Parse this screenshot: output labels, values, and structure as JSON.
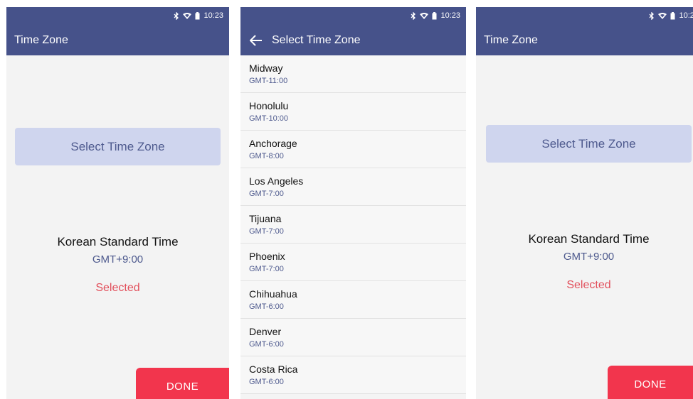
{
  "status_time": "10:23",
  "left_screen": {
    "title": "Time Zone",
    "select_button_label": "Select Time Zone",
    "timezone_name": "Korean Standard Time",
    "timezone_offset": "GMT+9:00",
    "selected_label": "Selected",
    "done_label": "DONE"
  },
  "middle_screen": {
    "title": "Select Time Zone",
    "items": [
      {
        "city": "Midway",
        "offset": "GMT-11:00"
      },
      {
        "city": "Honolulu",
        "offset": "GMT-10:00"
      },
      {
        "city": "Anchorage",
        "offset": "GMT-8:00"
      },
      {
        "city": "Los Angeles",
        "offset": "GMT-7:00"
      },
      {
        "city": "Tijuana",
        "offset": "GMT-7:00"
      },
      {
        "city": "Phoenix",
        "offset": "GMT-7:00"
      },
      {
        "city": "Chihuahua",
        "offset": "GMT-6:00"
      },
      {
        "city": "Denver",
        "offset": "GMT-6:00"
      },
      {
        "city": "Costa Rica",
        "offset": "GMT-6:00"
      }
    ]
  },
  "right_screen": {
    "title": "Time Zone",
    "select_button_label": "Select Time Zone",
    "timezone_name": "Korean Standard Time",
    "timezone_offset": "GMT+9:00",
    "selected_label": "Selected",
    "done_label": "DONE"
  },
  "icons": {
    "status": [
      "bluetooth-icon",
      "wifi-icon",
      "battery-icon"
    ],
    "back": "arrow-left-icon"
  },
  "colors": {
    "app_bar": "#46528a",
    "select_button": "#cfd5ee",
    "accent_text": "#4e5a8e",
    "selected_text": "#e2505c",
    "done_button": "#f2354d"
  }
}
